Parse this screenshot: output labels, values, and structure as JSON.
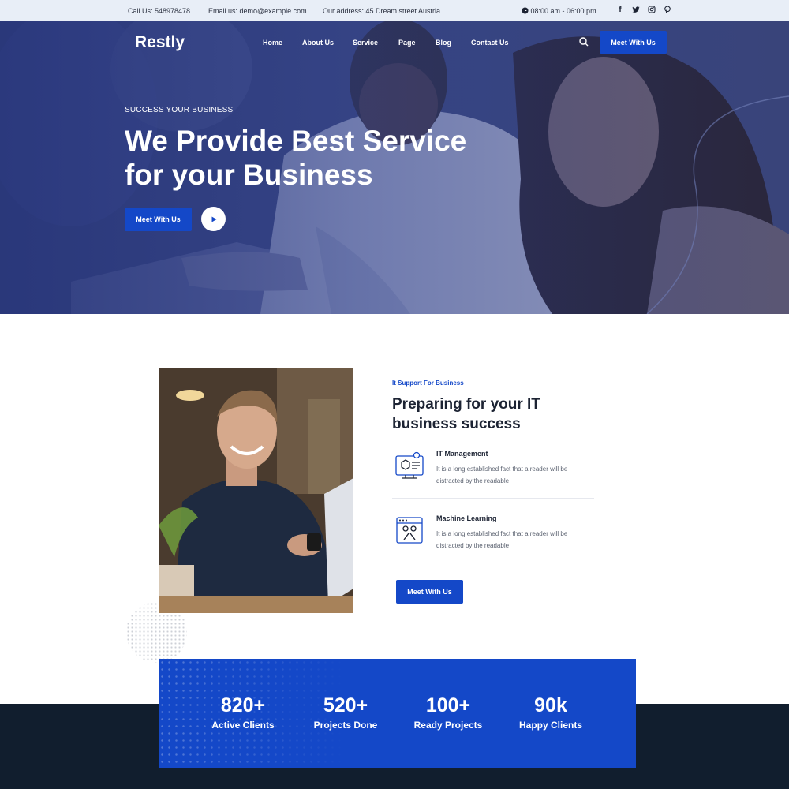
{
  "topbar": {
    "phone": "Call Us: 548978478",
    "email": "Email us: demo@example.com",
    "address": "Our address: 45 Dream street Austria",
    "hours": "08:00 am - 06:00 pm",
    "social": [
      {
        "icon": "facebook-icon",
        "glyph": "f"
      },
      {
        "icon": "twitter-icon",
        "glyph": "t"
      },
      {
        "icon": "instagram-icon",
        "glyph": "◎"
      },
      {
        "icon": "pinterest-icon",
        "glyph": "p"
      }
    ]
  },
  "header": {
    "logo": "Restly",
    "nav": [
      "Home",
      "About Us",
      "Service",
      "Page",
      "Blog",
      "Contact Us"
    ],
    "cta": "Meet With Us"
  },
  "hero": {
    "eyebrow": "SUCCESS YOUR BUSINESS",
    "title_line1": "We Provide Best Service",
    "title_line2": "for your Business",
    "cta": "Meet With Us"
  },
  "about": {
    "kicker": "It Support For Business",
    "title": "Preparing for your IT business success",
    "features": [
      {
        "title": "IT Management",
        "desc": "It is a long established fact that a reader will be distracted by the readable",
        "icon": "it-management-icon"
      },
      {
        "title": "Machine Learning",
        "desc": "It is a long established fact that a reader will be distracted by the readable",
        "icon": "machine-learning-icon"
      }
    ],
    "cta": "Meet With Us"
  },
  "stats": [
    {
      "value": "820+",
      "label": "Active Clients"
    },
    {
      "value": "520+",
      "label": "Projects Done"
    },
    {
      "value": "100+",
      "label": "Ready Projects"
    },
    {
      "value": "90k",
      "label": "Happy Clients"
    }
  ],
  "colors": {
    "brand": "#1448c8",
    "topbar_bg": "#e8eef7",
    "footer_bg": "#111e2e",
    "text_dark": "#1c2333"
  }
}
